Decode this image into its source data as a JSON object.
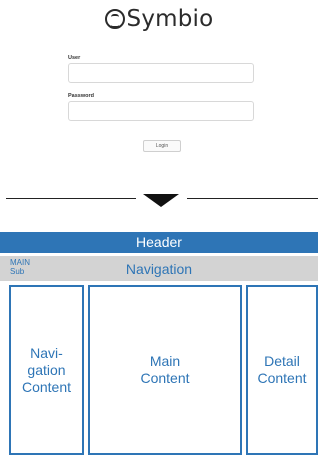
{
  "brand": {
    "name": "Symbio",
    "icon": "symbio-logo-icon"
  },
  "login": {
    "user_label": "User",
    "password_label": "Password",
    "button_label": "Login"
  },
  "layout": {
    "header": "Header",
    "nav_main": "MAIN",
    "nav_sub": "Sub",
    "navigation": "Navigation",
    "left_panel": "Navi-\ngation\nContent",
    "center_panel": "Main\nContent",
    "right_panel": "Detail\nContent"
  },
  "colors": {
    "accent": "#2e75b6",
    "nav_bg": "#d3d3d3",
    "header_text": "#ffffff"
  }
}
